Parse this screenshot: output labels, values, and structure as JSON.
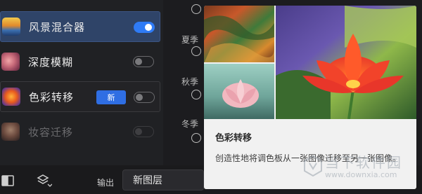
{
  "filters": [
    {
      "label": "风景混合器",
      "enabled": true,
      "selected": true,
      "disabled": false,
      "badge": ""
    },
    {
      "label": "深度模糊",
      "enabled": false,
      "selected": false,
      "disabled": false,
      "badge": ""
    },
    {
      "label": "色彩转移",
      "enabled": false,
      "selected": false,
      "disabled": false,
      "badge": "新"
    },
    {
      "label": "妆容迁移",
      "enabled": false,
      "selected": false,
      "disabled": true,
      "badge": ""
    }
  ],
  "seasons": [
    "夏季",
    "秋季",
    "冬季"
  ],
  "tooltip": {
    "title": "色彩转移",
    "description": "创造性地将调色板从一张图像迁移至另一张图像。"
  },
  "bottom_bar": {
    "output_label": "输出",
    "output_value": "新图层"
  },
  "watermark": {
    "text": "当下软件园",
    "url": "www.downxia.com"
  },
  "colors": {
    "accent": "#2f7bf5",
    "selected_bg": "#2f4468",
    "panel_bg": "#202124",
    "popover_bg": "#f1f1f1"
  }
}
